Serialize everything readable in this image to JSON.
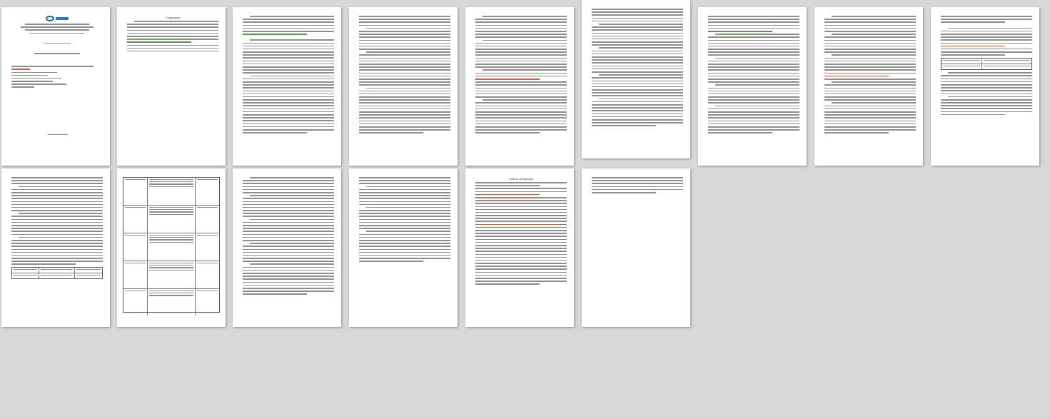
{
  "window": {
    "view_mode": "multi-page thumbnail view"
  },
  "pages": [
    {
      "id": 1,
      "type": "title",
      "page_number": ""
    },
    {
      "id": 2,
      "type": "toc",
      "heading": "Содержание",
      "page_number": ""
    },
    {
      "id": 3,
      "type": "text",
      "page_number": ""
    },
    {
      "id": 4,
      "type": "text",
      "page_number": ""
    },
    {
      "id": 5,
      "type": "text",
      "page_number": ""
    },
    {
      "id": 6,
      "type": "text",
      "page_number": ""
    },
    {
      "id": 7,
      "type": "text",
      "page_number": ""
    },
    {
      "id": 8,
      "type": "text",
      "page_number": ""
    },
    {
      "id": 9,
      "type": "text-table",
      "page_number": ""
    },
    {
      "id": 10,
      "type": "text-table",
      "page_number": ""
    },
    {
      "id": 11,
      "type": "table",
      "page_number": ""
    },
    {
      "id": 12,
      "type": "text",
      "page_number": ""
    },
    {
      "id": 13,
      "type": "text",
      "page_number": ""
    },
    {
      "id": 14,
      "type": "references",
      "heading": "Список литературы",
      "page_number": ""
    },
    {
      "id": 15,
      "type": "short",
      "page_number": ""
    }
  ],
  "colors": {
    "background": "#d7d7d7",
    "page": "#ffffff",
    "text_line": "#7a7a7a",
    "highlight_red": "#c24a3a",
    "highlight_green": "#4a8a3a",
    "logo_blue": "#1f5fa8"
  }
}
